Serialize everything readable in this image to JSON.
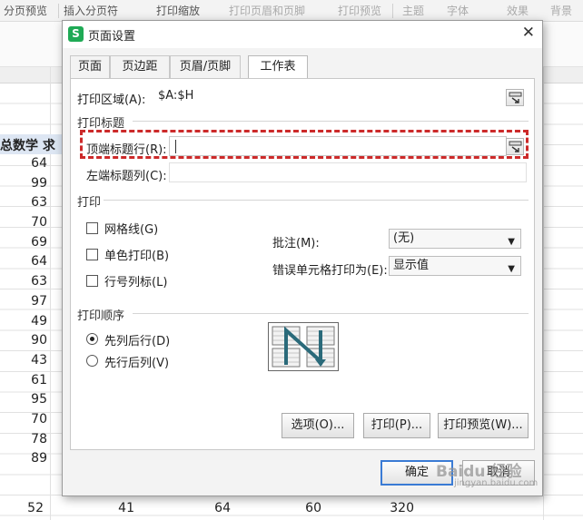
{
  "ribbon": {
    "items": [
      "分页预览",
      "插入分页符",
      "打印缩放",
      "打印页眉和页脚",
      "打印预览",
      "主题",
      "字体",
      "效果",
      "背景"
    ]
  },
  "sheet": {
    "header_text": "总数学  求",
    "column_values": [
      "64",
      "99",
      "63",
      "70",
      "69",
      "64",
      "63",
      "97",
      "49",
      "90",
      "43",
      "61",
      "95",
      "70",
      "78",
      "89"
    ],
    "bottom_row": [
      "52",
      "41",
      "64",
      "60",
      "320"
    ]
  },
  "dialog": {
    "title": "页面设置",
    "icon_letter": "S",
    "tabs": [
      "页面",
      "页边距",
      "页眉/页脚",
      "工作表"
    ],
    "active_tab": 3,
    "print_area_label": "打印区域(A):",
    "print_area_value": "$A:$H",
    "print_titles_section": "打印标题",
    "top_rows_label": "顶端标题行(R):",
    "top_rows_value": "",
    "left_cols_label": "左端标题列(C):",
    "left_cols_value": "",
    "print_section": "打印",
    "gridlines_label": "网格线(G)",
    "mono_label": "单色打印(B)",
    "row_col_headers_label": "行号列标(L)",
    "comments_label": "批注(M):",
    "comments_value": "(无)",
    "errors_label": "错误单元格打印为(E):",
    "errors_value": "显示值",
    "order_section": "打印顺序",
    "order_down_then_over": "先列后行(D)",
    "order_over_then_down": "先行后列(V)",
    "options_btn": "选项(O)...",
    "print_btn": "打印(P)...",
    "preview_btn": "打印预览(W)...",
    "ok_btn": "确定",
    "cancel_btn": "取消"
  },
  "watermark": {
    "text": "Baidu 经验",
    "sub": "jingyan.baidu.com"
  }
}
